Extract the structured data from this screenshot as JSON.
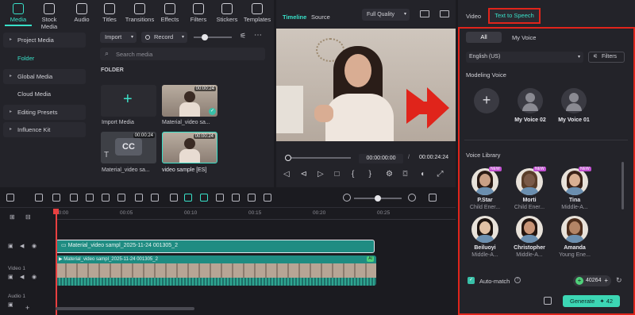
{
  "toolbar_tabs": [
    {
      "label": "Media",
      "icon": "media-icon",
      "active": true
    },
    {
      "label": "Stock Media",
      "icon": "stock-media-icon"
    },
    {
      "label": "Audio",
      "icon": "music-note-icon"
    },
    {
      "label": "Titles",
      "icon": "titles-icon"
    },
    {
      "label": "Transitions",
      "icon": "transitions-icon"
    },
    {
      "label": "Effects",
      "icon": "effects-icon"
    },
    {
      "label": "Filters",
      "icon": "filters-icon"
    },
    {
      "label": "Stickers",
      "icon": "stickers-icon"
    },
    {
      "label": "Templates",
      "icon": "templates-icon"
    }
  ],
  "sidebar": {
    "items": [
      {
        "label": "Project Media",
        "expandable": true
      },
      {
        "label": "Folder",
        "active": true
      },
      {
        "label": "Global Media",
        "expandable": true
      },
      {
        "label": "Cloud Media"
      },
      {
        "label": "Editing Presets",
        "expandable": true
      },
      {
        "label": "Influence Kit",
        "expandable": true
      }
    ]
  },
  "media_controls": {
    "import_label": "Import",
    "record_label": "Record",
    "search_placeholder": "Search media",
    "folder_heading": "FOLDER"
  },
  "media_items": [
    {
      "caption": "Import Media"
    },
    {
      "caption": "Material_video sa...",
      "duration": "00:00:24"
    },
    {
      "caption": "Material_video sa...",
      "duration": "00:00:24"
    },
    {
      "caption": "video sample [ES]",
      "duration": "00:00:24"
    }
  ],
  "preview": {
    "tab_timeline": "Timeline",
    "tab_source": "Source",
    "quality": "Full Quality",
    "time_current": "00:00:00:00",
    "time_total": "00:00:24:24"
  },
  "tts_panel": {
    "tab_video": "Video",
    "tab_tts": "Text to Speech",
    "filter_all": "All",
    "filter_my_voice": "My Voice",
    "language": "English (US)",
    "filters_label": "Filters",
    "modeling_heading": "Modeling Voice",
    "modeling_voices": [
      {
        "name": "My Voice 02"
      },
      {
        "name": "My Voice 01"
      }
    ],
    "library_heading": "Voice Library",
    "library_voices": [
      {
        "name": "P.Star",
        "desc": "Child Ener...",
        "is_new": true
      },
      {
        "name": "Morti",
        "desc": "Child Ener...",
        "is_new": true
      },
      {
        "name": "Tina",
        "desc": "Middle-A...",
        "is_new": true
      },
      {
        "name": "Beiluoyi",
        "desc": "Middle-A...",
        "is_new": false
      },
      {
        "name": "Christopher",
        "desc": "Middle-A...",
        "is_new": false
      },
      {
        "name": "Amanda",
        "desc": "Young Ene...",
        "is_new": false
      }
    ],
    "auto_match_label": "Auto-match",
    "credits": "40264",
    "generate_label": "Generate",
    "generate_cost": "42",
    "badge_new": "NEW"
  },
  "timeline": {
    "ruler_ticks": [
      "00:00",
      "00:05",
      "00:10",
      "00:15",
      "00:20",
      "00:25"
    ],
    "title_clip": "Material_video sampl_2025-11-24 001305_2",
    "video_clip": "Material_video sampl_2025-11-24 001305_2",
    "ai_badge": "AI",
    "track_video1": "Video 1",
    "track_audio1": "Audio 1"
  },
  "colors": {
    "accent": "#38e0c8",
    "highlight_box": "#e0241b",
    "clip_teal": "#1f8c82",
    "panel_bg": "#232329"
  }
}
